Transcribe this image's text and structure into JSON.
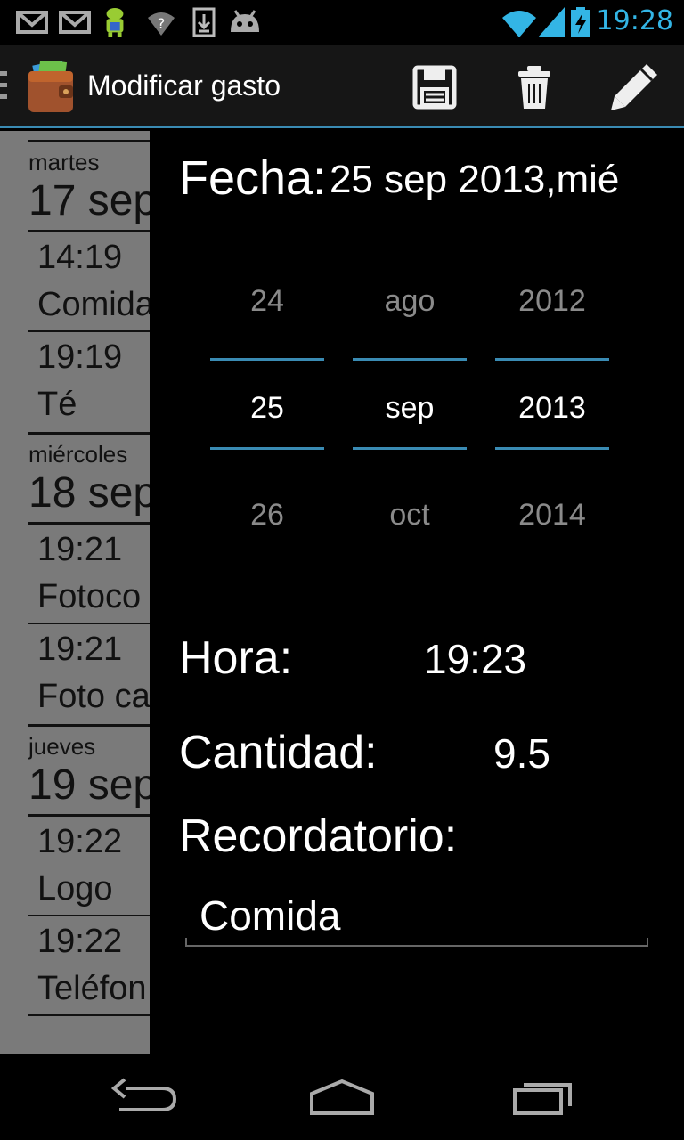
{
  "status_bar": {
    "time": "19:28",
    "left_icons": [
      "gmail-icon",
      "gmail-icon",
      "android-icon",
      "wifi-question-icon",
      "download-icon",
      "android-head-icon"
    ],
    "right_icons": [
      "wifi-icon",
      "signal-icon",
      "battery-charging-icon"
    ],
    "accent_color": "#33b5e5"
  },
  "action_bar": {
    "title": "Modificar gasto",
    "actions": [
      "save-icon",
      "trash-icon",
      "pencil-icon"
    ]
  },
  "list": {
    "days": [
      {
        "name": "martes",
        "date": "17 sep",
        "entries": [
          {
            "time": "14:19",
            "desc": "Comida"
          },
          {
            "time": "19:19",
            "desc": "Té"
          }
        ]
      },
      {
        "name": "miércoles",
        "date": "18 sep",
        "entries": [
          {
            "time": "19:21",
            "desc": "Fotoco"
          },
          {
            "time": "19:21",
            "desc": "Foto ca"
          }
        ]
      },
      {
        "name": "jueves",
        "date": "19 sep",
        "entries": [
          {
            "time": "19:22",
            "desc": "Logo"
          },
          {
            "time": "19:22",
            "desc": "Teléfon"
          }
        ]
      }
    ]
  },
  "dialog": {
    "fecha_label": "Fecha:",
    "fecha_value": "25 sep 2013,mié",
    "picker": {
      "day": {
        "prev": "24",
        "cur": "25",
        "next": "26"
      },
      "month": {
        "prev": "ago",
        "cur": "sep",
        "next": "oct"
      },
      "year": {
        "prev": "2012",
        "cur": "2013",
        "next": "2014"
      }
    },
    "hora_label": "Hora:",
    "hora_value": "19:23",
    "cantidad_label": "Cantidad:",
    "cantidad_value": "9.5",
    "recordatorio_label": "Recordatorio:",
    "recordatorio_value": "Comida"
  },
  "nav_bar": {
    "buttons": [
      "back-icon",
      "home-icon",
      "recents-icon"
    ]
  }
}
